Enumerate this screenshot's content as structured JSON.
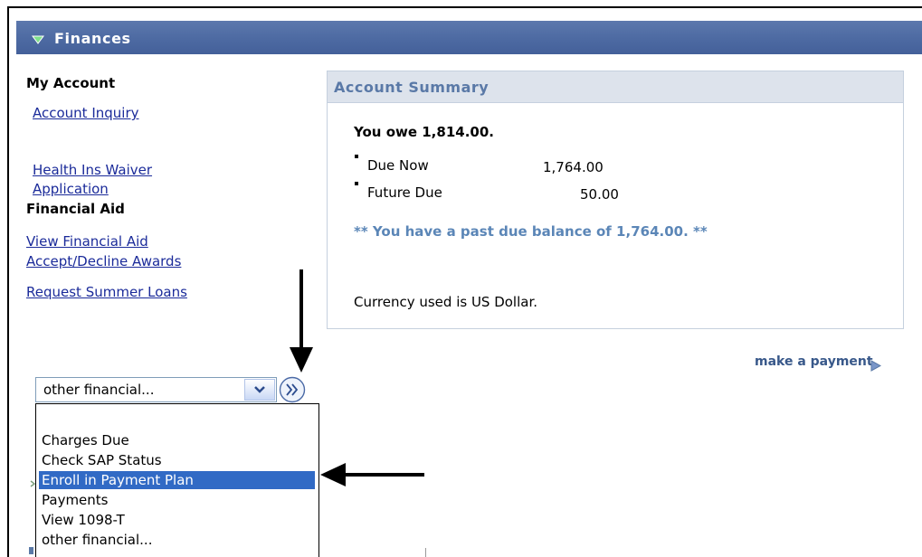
{
  "header": {
    "title": "Finances"
  },
  "my_account": {
    "heading": "My Account",
    "links": [
      "Account Inquiry",
      "Health Ins Waiver",
      "Application"
    ]
  },
  "financial_aid": {
    "heading": "Financial Aid",
    "links": [
      "View Financial Aid",
      "Accept/Decline Awards",
      "Request Summer Loans"
    ]
  },
  "account_summary": {
    "heading": "Account Summary",
    "owe": "You owe 1,814.00.",
    "items": [
      {
        "label": "Due Now",
        "amount": "1,764.00"
      },
      {
        "label": "Future Due",
        "amount": "50.00"
      }
    ],
    "past_due": "** You have a past due balance of 1,764.00. **",
    "currency": "Currency used is US Dollar."
  },
  "make_payment": "make a payment",
  "select": {
    "value": "other financial...",
    "options": [
      "Charges Due",
      "Check SAP Status",
      "Enroll in Payment Plan",
      "Payments",
      "View 1098-T",
      "other financial..."
    ],
    "highlighted": "Enroll in Payment Plan"
  },
  "icons": {
    "header": "triangle-down-icon",
    "select": "chevron-down-icon",
    "go": "double-chevron-right-icon",
    "payment": "triangle-right-icon",
    "annotation": "arrow-icon"
  },
  "colors": {
    "header_bg": "#4d6aa2",
    "link": "#1b2b9a",
    "summary_header_bg": "#dde3ec",
    "summary_title": "#5a79a7",
    "past_due": "#5b86b7",
    "selection": "#316ac5"
  }
}
